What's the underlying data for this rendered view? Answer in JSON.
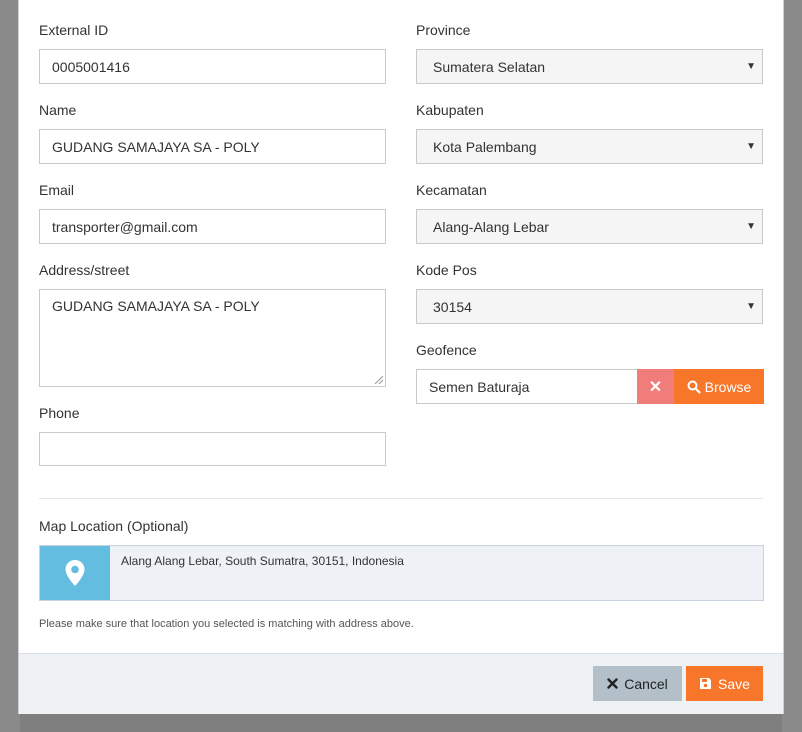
{
  "form": {
    "external_id": {
      "label": "External ID",
      "value": "0005001416"
    },
    "name": {
      "label": "Name",
      "value": "GUDANG SAMAJAYA SA - POLY"
    },
    "email": {
      "label": "Email",
      "value": "transporter@gmail.com"
    },
    "address": {
      "label": "Address/street",
      "value": "GUDANG SAMAJAYA SA - POLY"
    },
    "phone": {
      "label": "Phone",
      "value": ""
    },
    "province": {
      "label": "Province",
      "value": "Sumatera Selatan"
    },
    "kabupaten": {
      "label": "Kabupaten",
      "value": "Kota Palembang"
    },
    "kecamatan": {
      "label": "Kecamatan",
      "value": "Alang-Alang Lebar"
    },
    "kode_pos": {
      "label": "Kode Pos",
      "value": "30154"
    },
    "geofence": {
      "label": "Geofence",
      "value": "Semen Baturaja",
      "clear_icon": "✕",
      "browse_label": "Browse"
    }
  },
  "map": {
    "label": "Map Location (Optional)",
    "address": "Alang Alang Lebar, South Sumatra, 30151, Indonesia",
    "hint": "Please make sure that location you selected is matching with address above."
  },
  "footer": {
    "cancel_label": "Cancel",
    "save_label": "Save"
  },
  "colors": {
    "accent": "#f7762a",
    "danger": "#f07d7a",
    "map_pin_bg": "#62bde0"
  },
  "icons": {
    "caret": "caret-down-icon",
    "clear": "close-icon",
    "browse": "search-icon",
    "map": "map-pin-icon",
    "cancel": "close-icon",
    "save": "save-icon"
  }
}
